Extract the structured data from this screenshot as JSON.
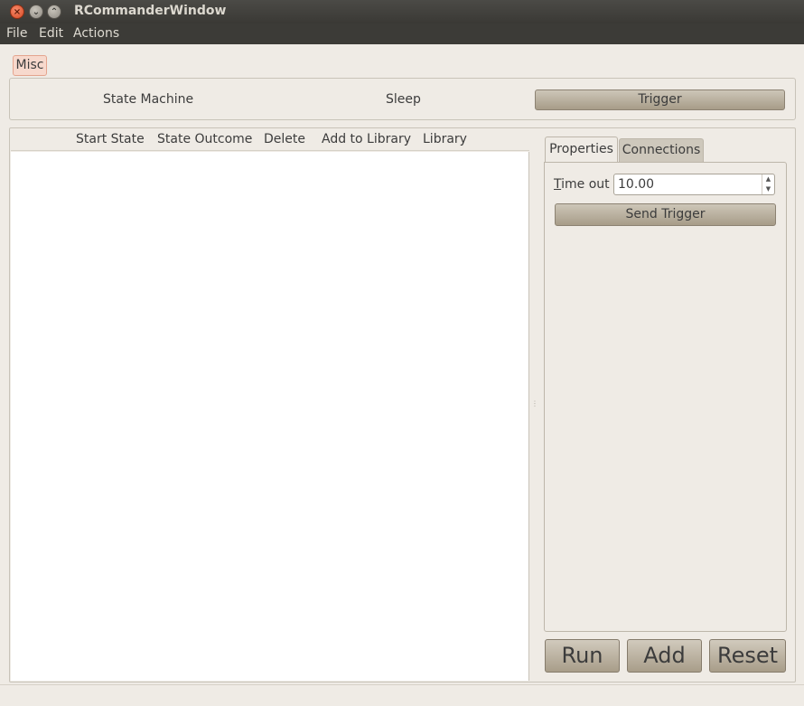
{
  "window": {
    "title": "RCommanderWindow"
  },
  "menu": {
    "items": [
      "File",
      "Edit",
      "Actions"
    ]
  },
  "top_tabs": {
    "misc": "Misc"
  },
  "top_frame": {
    "state_machine": "State Machine",
    "sleep": "Sleep",
    "trigger": "Trigger"
  },
  "columns": [
    "Start State",
    "State Outcome",
    "Delete",
    "Add to Library",
    "Library"
  ],
  "side_tabs": {
    "properties": "Properties",
    "connections": "Connections"
  },
  "properties": {
    "timeout_label": "Time out",
    "timeout_mnemonic": "T",
    "timeout_rest": "ime out",
    "timeout_value": "10.00",
    "send_trigger": "Send Trigger"
  },
  "actions": {
    "run": "Run",
    "add": "Add",
    "reset": "Reset"
  }
}
